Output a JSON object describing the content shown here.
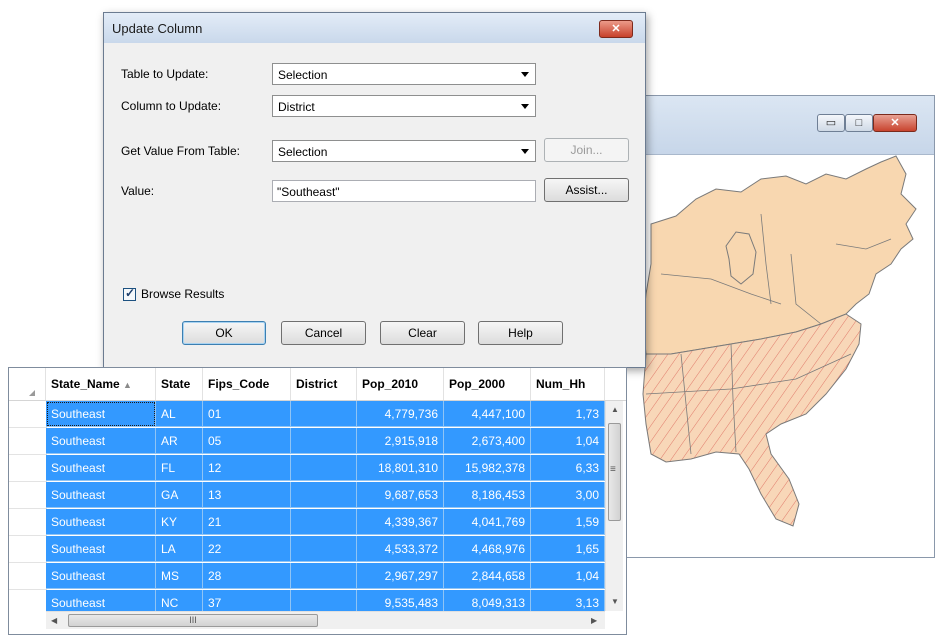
{
  "map_window": {
    "buttons": {
      "minimize_glyph": "▭",
      "maximize_glyph": "□",
      "close_glyph": "✕"
    }
  },
  "dialog": {
    "title": "Update Column",
    "close_glyph": "✕",
    "table_to_update": {
      "label": "Table to Update:",
      "value": "Selection"
    },
    "column_to_update": {
      "label": "Column to Update:",
      "value": "District"
    },
    "get_value_from_table": {
      "label": "Get Value From Table:",
      "value": "Selection"
    },
    "join_label": "Join...",
    "value_field": {
      "label": "Value:",
      "value": "\"Southeast\""
    },
    "assist_label": "Assist...",
    "browse_results": {
      "label": "Browse Results",
      "checked": true,
      "check_glyph": "✓"
    },
    "ok_label": "OK",
    "cancel_label": "Cancel",
    "clear_label": "Clear",
    "help_label": "Help"
  },
  "browser": {
    "columns": [
      "State_Name",
      "State",
      "Fips_Code",
      "District",
      "Pop_2010",
      "Pop_2000",
      "Num_Hh"
    ],
    "sort_glyph": "▲",
    "rows": [
      [
        "Southeast",
        "AL",
        "01",
        "",
        "4,779,736",
        "4,447,100",
        "1,73"
      ],
      [
        "Southeast",
        "AR",
        "05",
        "",
        "2,915,918",
        "2,673,400",
        "1,04"
      ],
      [
        "Southeast",
        "FL",
        "12",
        "",
        "18,801,310",
        "15,982,378",
        "6,33"
      ],
      [
        "Southeast",
        "GA",
        "13",
        "",
        "9,687,653",
        "8,186,453",
        "3,00"
      ],
      [
        "Southeast",
        "KY",
        "21",
        "",
        "4,339,367",
        "4,041,769",
        "1,59"
      ],
      [
        "Southeast",
        "LA",
        "22",
        "",
        "4,533,372",
        "4,468,976",
        "1,65"
      ],
      [
        "Southeast",
        "MS",
        "28",
        "",
        "2,967,297",
        "2,844,658",
        "1,04"
      ],
      [
        "Southeast",
        "NC",
        "37",
        "",
        "9,535,483",
        "8,049,313",
        "3,13"
      ]
    ],
    "scroll": {
      "up": "▲",
      "down": "▼",
      "left": "◀",
      "right": "▶",
      "hthumb_grip": "III",
      "vthumb_grip": "≡"
    },
    "colors": {
      "selection": "#3399ff"
    }
  }
}
